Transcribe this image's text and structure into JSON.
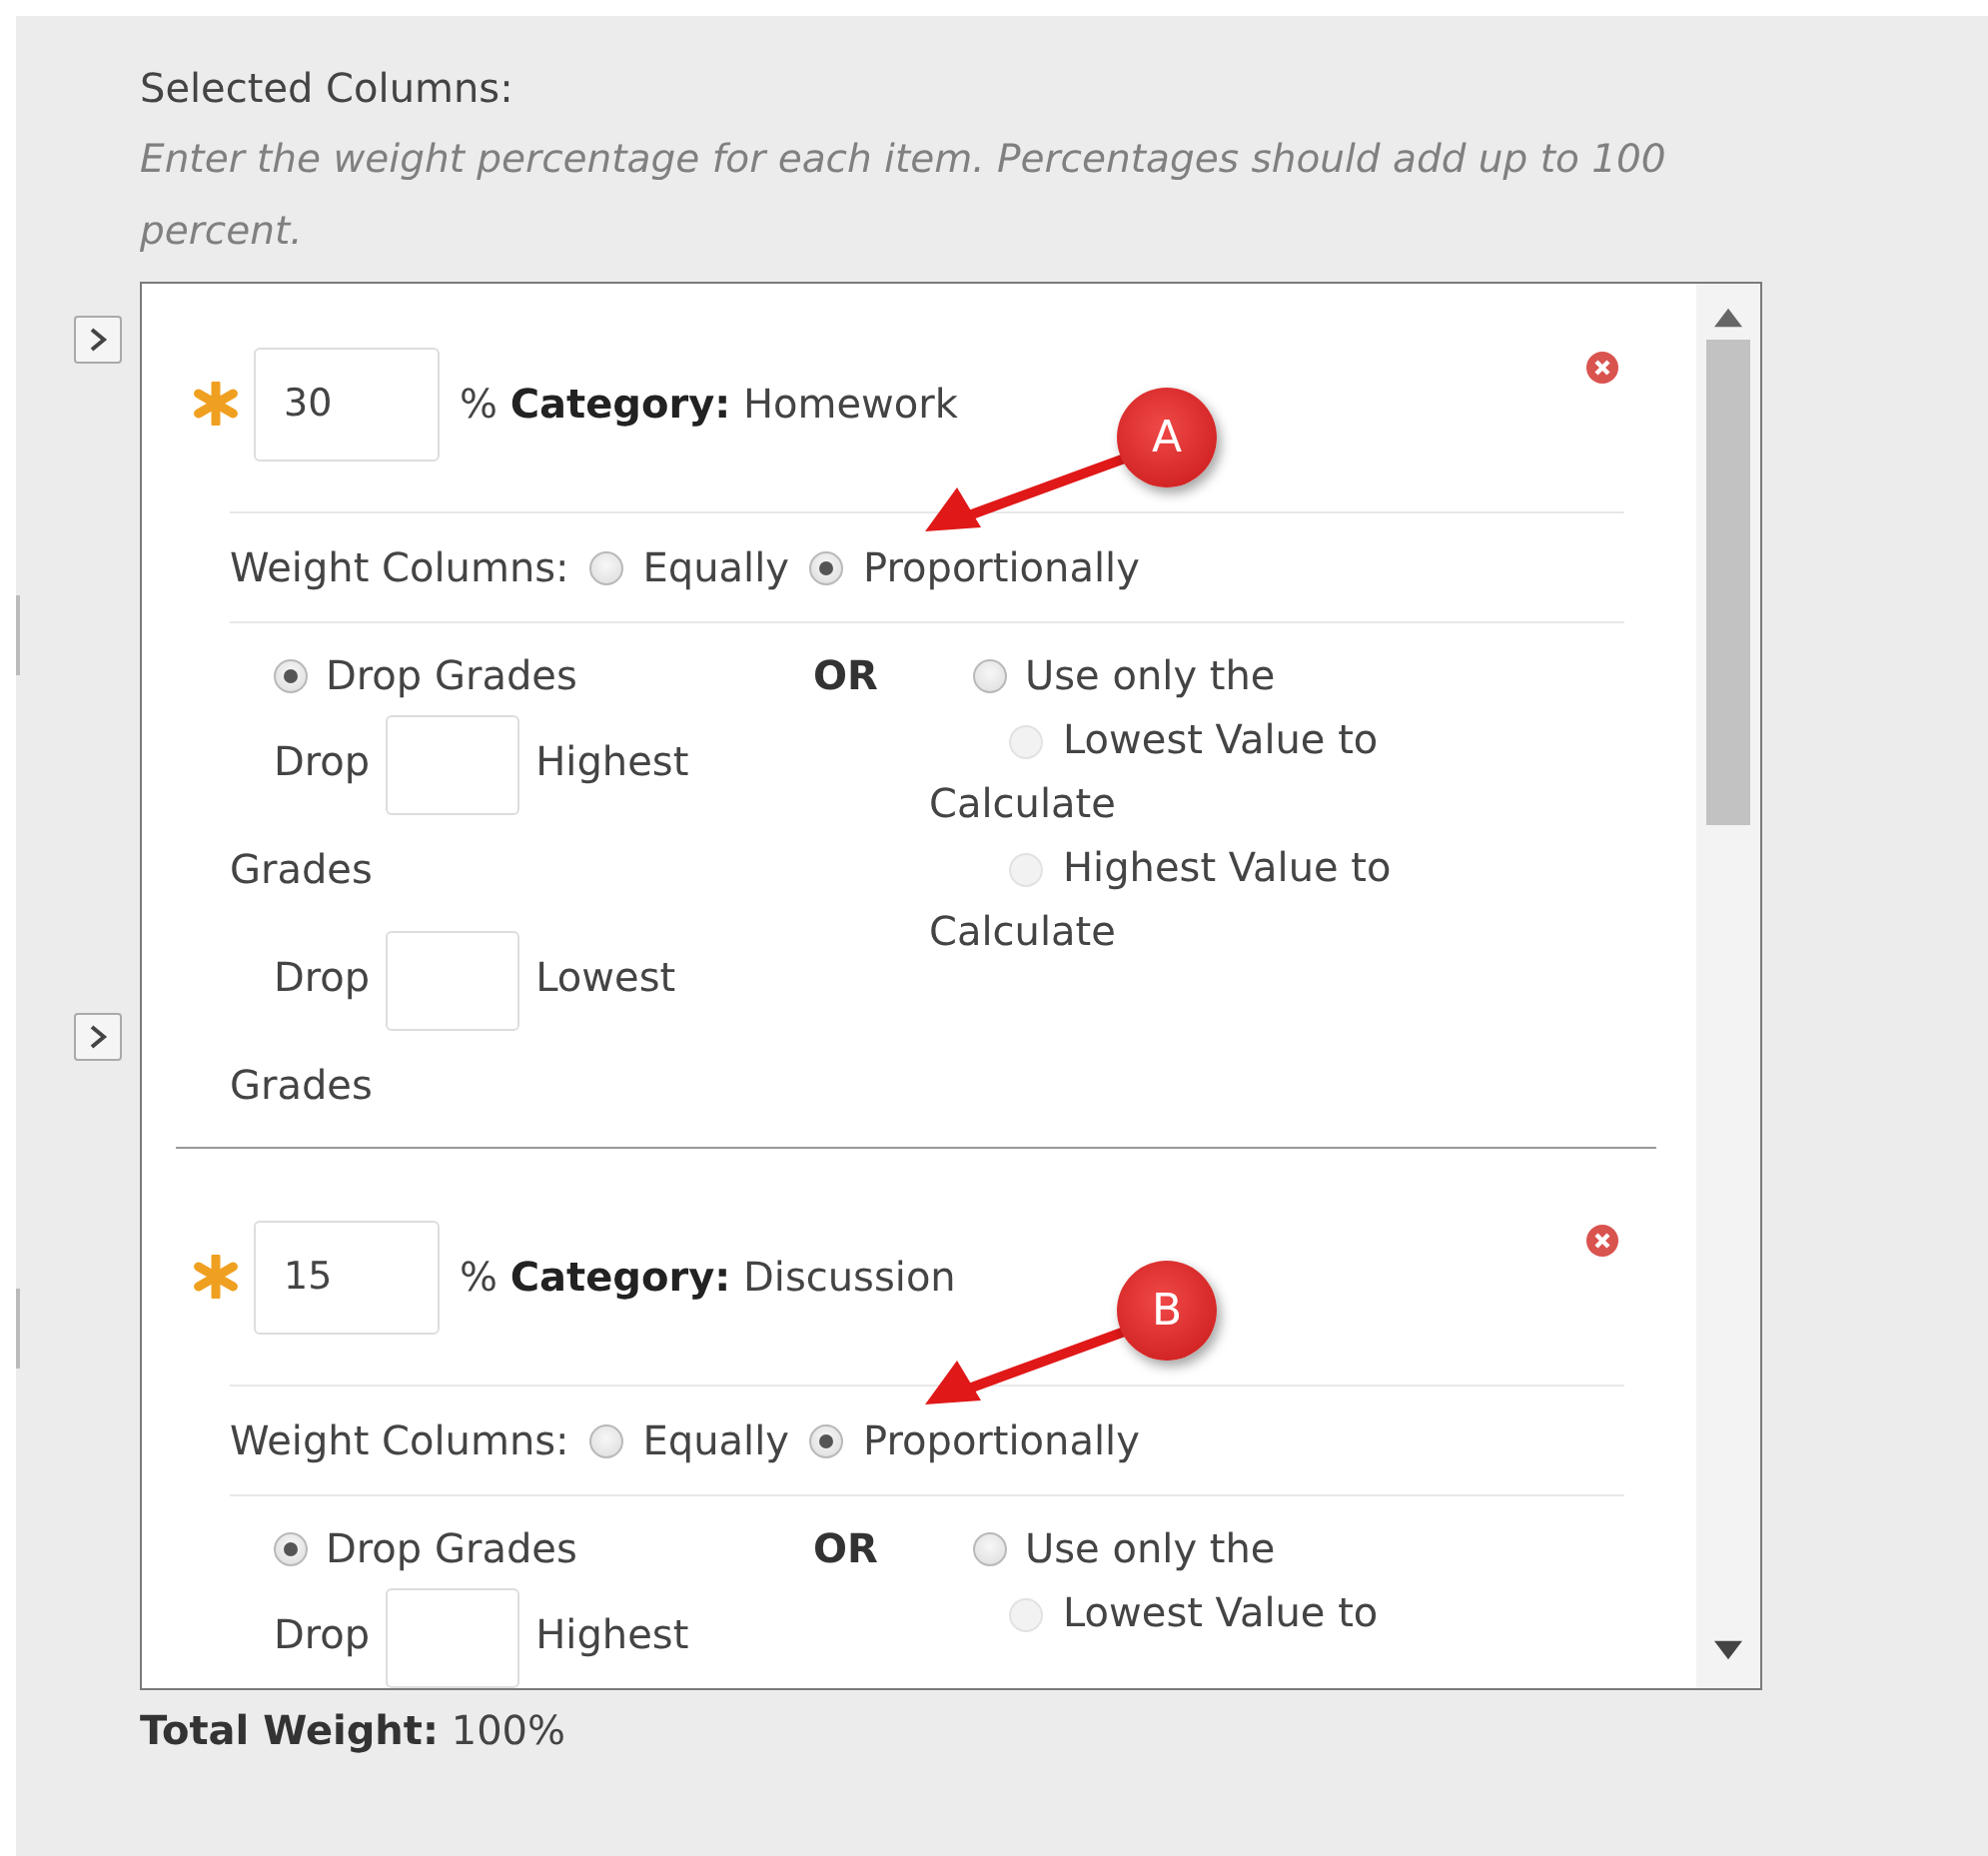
{
  "heading": "Selected Columns:",
  "instructions": "Enter the weight percentage for each item. Percentages should add up to 100 percent.",
  "categories": [
    {
      "required": true,
      "percent": "30",
      "percent_sign": "%",
      "category_label": "Category:",
      "category_name": "Homework",
      "weight_label": "Weight Columns:",
      "weight_options": [
        {
          "label": "Equally",
          "selected": false
        },
        {
          "label": "Proportionally",
          "selected": true
        }
      ],
      "drop_option": {
        "label": "Drop Grades",
        "selected": true
      },
      "or_label": "OR",
      "use_option": {
        "label": "Use only the",
        "selected": false
      },
      "drop_fields": [
        {
          "prefix": "Drop",
          "suffix": "Highest",
          "continuation": "Grades"
        },
        {
          "prefix": "Drop",
          "suffix": "Lowest",
          "continuation": "Grades"
        }
      ],
      "value_options": [
        {
          "label": "Lowest Value to",
          "continuation": "Calculate",
          "selected": false,
          "disabled": true
        },
        {
          "label": "Highest Value to",
          "continuation": "Calculate",
          "selected": false,
          "disabled": true
        }
      ],
      "callout": "A"
    },
    {
      "required": true,
      "percent": "15",
      "percent_sign": "%",
      "category_label": "Category:",
      "category_name": "Discussion",
      "weight_label": "Weight Columns:",
      "weight_options": [
        {
          "label": "Equally",
          "selected": false
        },
        {
          "label": "Proportionally",
          "selected": true
        }
      ],
      "drop_option": {
        "label": "Drop Grades",
        "selected": true
      },
      "or_label": "OR",
      "use_option": {
        "label": "Use only the",
        "selected": false
      },
      "drop_fields": [
        {
          "prefix": "Drop",
          "suffix": "Highest"
        }
      ],
      "value_options": [
        {
          "label": "Lowest Value to",
          "selected": false,
          "disabled": true
        }
      ],
      "callout": "B"
    }
  ],
  "total_label": "Total Weight:",
  "total_value": "100%"
}
